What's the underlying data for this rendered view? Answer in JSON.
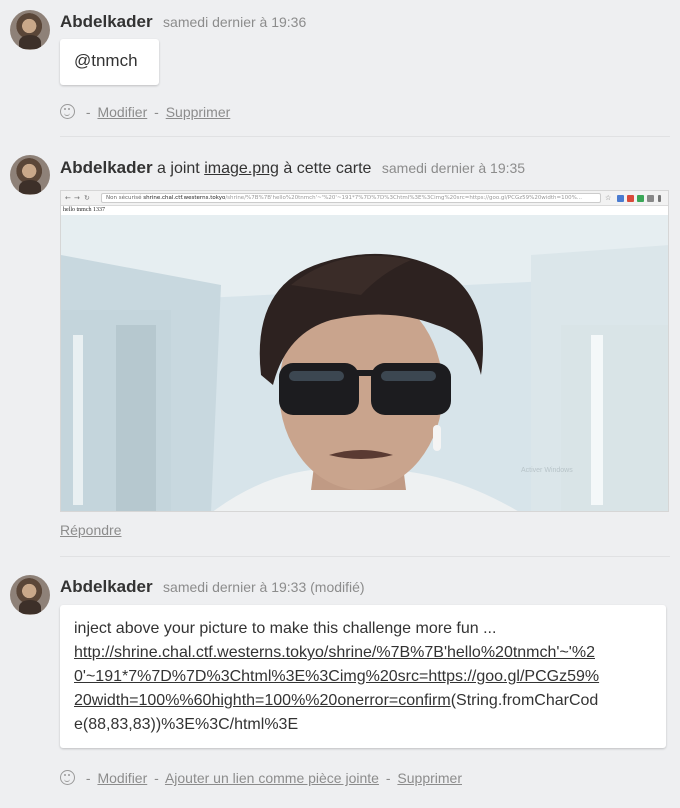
{
  "comments": [
    {
      "author": "Abdelkader",
      "date": "samedi dernier à 19:36",
      "text": "@tnmch",
      "actions": [
        "Modifier",
        "Supprimer"
      ],
      "separator": "-"
    },
    {
      "author": "Abdelkader",
      "attach_prefix": "a joint",
      "attach_file": "image.png",
      "attach_suffix": "à cette carte",
      "date": "samedi dernier à 19:35",
      "reply": "Répondre",
      "screenshot": {
        "url_prefix": "Non sécurisé",
        "url_host": "shrine.chal.ctf.westerns.tokyo",
        "url_path": "/shrine/%7B%7B'hello%20tnmch'~'%20'~191*7%7D%7D%3Chtml%3E%3Cimg%20src=https://goo.gl/PCGz59%20width=100%...",
        "page_text": "hello tnmch 1337",
        "watermark": "Activer Windows"
      }
    },
    {
      "author": "Abdelkader",
      "date": "samedi dernier à 19:33 (modifié)",
      "text_intro": "inject above your picture to make this challenge more fun ...",
      "link_lines": [
        "http://shrine.chal.ctf.westerns.tokyo/shrine/%7B%7B'hello%20tnmch'~'%2",
        "0'~191*7%7D%7D%3Chtml%3E%3Cimg%20src=https://goo.gl/PCGz59%",
        "20width=100%%60highth=100%%20onerror=confirm"
      ],
      "tail_a": "(String.fromCharCod",
      "tail_b": "e(88,83,83))%3E%3C/html%3E",
      "actions": [
        "Modifier",
        "Ajouter un lien comme pièce jointe",
        "Supprimer"
      ],
      "separator": "-"
    }
  ],
  "colors": {
    "background": "#eeeff1",
    "card": "#ffffff",
    "meta": "#8c8c8c",
    "author": "#333333"
  },
  "icons": [
    "reaction-icon",
    "back-icon",
    "forward-icon",
    "reload-icon",
    "star-icon"
  ]
}
